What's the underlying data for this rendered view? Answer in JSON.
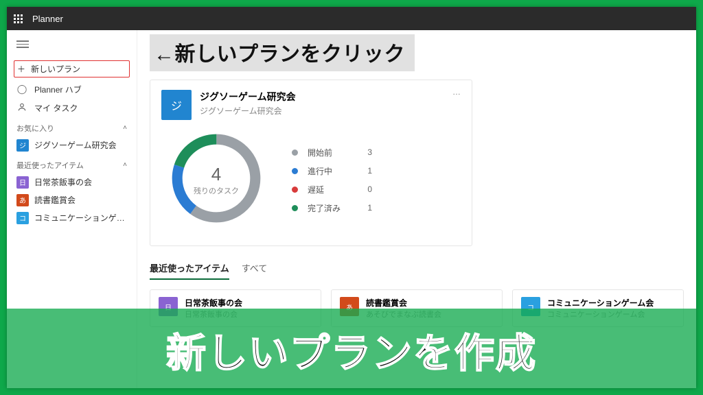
{
  "header": {
    "app_name": "Planner"
  },
  "sidebar": {
    "new_plan_label": "新しいプラン",
    "hub_label": "Planner ハブ",
    "my_tasks_label": "マイ タスク",
    "favorites_label": "お気に入り",
    "recent_label": "最近使ったアイテム",
    "favorites": [
      {
        "initial": "ジ",
        "color": "#2185d0",
        "label": "ジグソーゲーム研究会"
      }
    ],
    "recent": [
      {
        "initial": "日",
        "color": "#8a63d2",
        "label": "日常茶飯事の会"
      },
      {
        "initial": "あ",
        "color": "#d24a1b",
        "label": "読書鑑賞会"
      },
      {
        "initial": "コ",
        "color": "#2aa0e0",
        "label": "コミュニケーションゲ…"
      }
    ]
  },
  "annotation": {
    "arrow_text": "←新しいプランをクリック",
    "banner_text": "新しいプランを作成"
  },
  "card": {
    "initial": "ジ",
    "tile_color": "#2185d0",
    "title": "ジグソーゲーム研究会",
    "subtitle": "ジグソーゲーム研究会",
    "more": "…",
    "remaining_count": "4",
    "remaining_label": "残りのタスク",
    "legend": [
      {
        "label": "開始前",
        "value": "3",
        "color": "#9aa0a6"
      },
      {
        "label": "進行中",
        "value": "1",
        "color": "#2b7cd3"
      },
      {
        "label": "遅延",
        "value": "0",
        "color": "#d83b3b"
      },
      {
        "label": "完了済み",
        "value": "1",
        "color": "#1e8e5a"
      }
    ]
  },
  "tabs": {
    "recent": "最近使ったアイテム",
    "all": "すべて"
  },
  "recent_cards": [
    {
      "initial": "日",
      "color": "#8a63d2",
      "title": "日常茶飯事の会",
      "subtitle": "日常茶飯事の会"
    },
    {
      "initial": "あ",
      "color": "#d24a1b",
      "title": "読書鑑賞会",
      "subtitle": "あそびでまなぶ読書会"
    },
    {
      "initial": "コ",
      "color": "#2aa0e0",
      "title": "コミュニケーションゲーム会",
      "subtitle": "コミュニケーションゲーム会"
    }
  ],
  "chart_data": {
    "type": "pie",
    "title": "残りのタスク",
    "center_value": 4,
    "series": [
      {
        "name": "開始前",
        "value": 3,
        "color": "#9aa0a6"
      },
      {
        "name": "進行中",
        "value": 1,
        "color": "#2b7cd3"
      },
      {
        "name": "遅延",
        "value": 0,
        "color": "#d83b3b"
      },
      {
        "name": "完了済み",
        "value": 1,
        "color": "#1e8e5a"
      }
    ]
  }
}
